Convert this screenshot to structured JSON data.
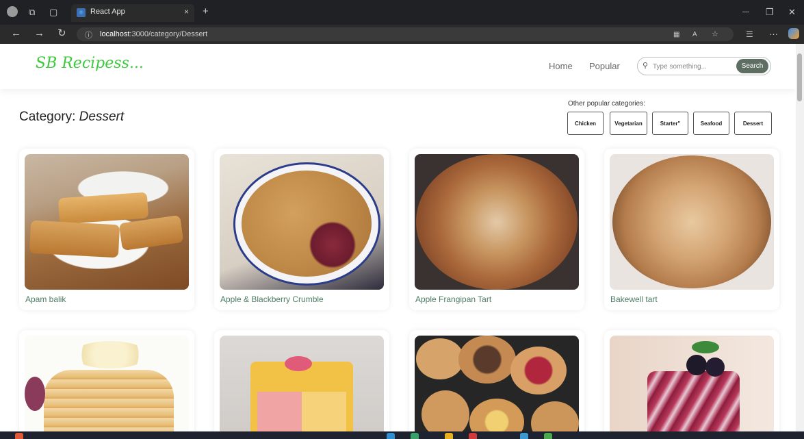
{
  "browser": {
    "tab_title": "React App",
    "tab_close": "×",
    "new_tab": "+",
    "url_host": "localhost",
    "url_rest": ":3000/category/Dessert",
    "info_icon": "ⓘ",
    "back": "←",
    "forward": "→",
    "reload": "↻",
    "minimize": "—",
    "restore": "❐",
    "close": "✕",
    "menu": "···"
  },
  "navbar": {
    "logo": "SB Recipess...",
    "links": [
      "Home",
      "Popular"
    ],
    "search_placeholder": "Type something...",
    "search_button": "Search"
  },
  "category": {
    "prefix": "Category: ",
    "name": "Dessert",
    "other_label": "Other popular categories:",
    "buttons": [
      "Chicken",
      "Vegetarian",
      "Starter\"",
      "Seafood",
      "Dessert"
    ]
  },
  "recipes": [
    {
      "name": "Apam balik"
    },
    {
      "name": "Apple & Blackberry Crumble"
    },
    {
      "name": "Apple Frangipan Tart"
    },
    {
      "name": "Bakewell tart"
    }
  ],
  "icons": {
    "search": "search-icon",
    "profile": "profile-icon",
    "workspaces": "workspaces-icon",
    "tab_actions": "tab-actions-icon",
    "react": "react-icon"
  }
}
